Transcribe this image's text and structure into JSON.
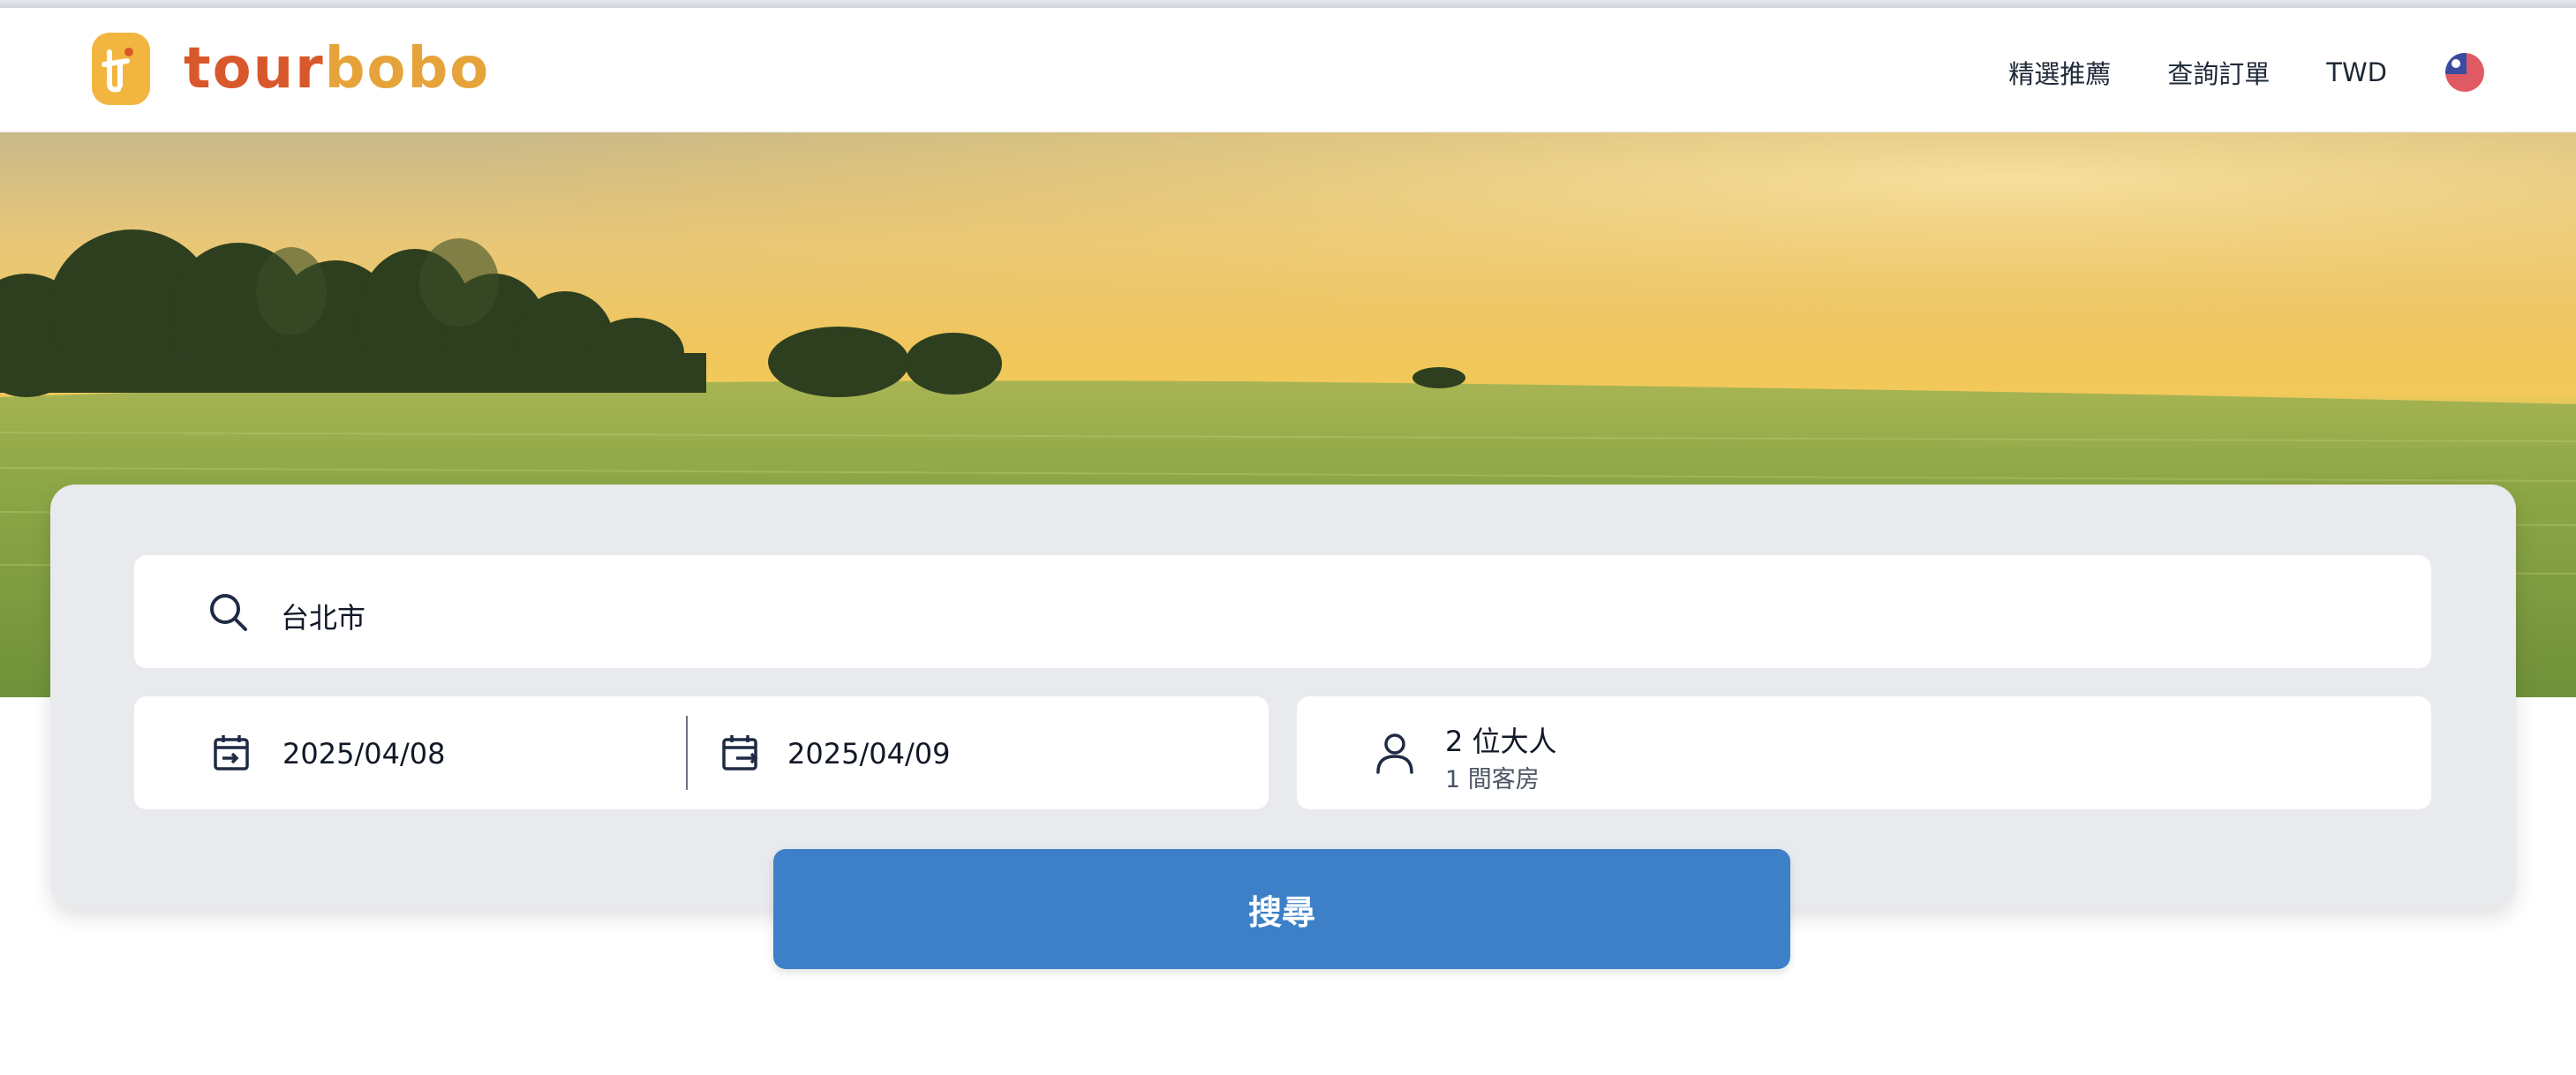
{
  "brand": {
    "name_part1": "tour",
    "name_part2": "bobo",
    "primary_color": "#d9582b",
    "accent_color": "#e6a33a",
    "logo_bg": "#f2b640"
  },
  "nav": {
    "items": [
      {
        "label": "精選推薦"
      },
      {
        "label": "查詢訂單"
      },
      {
        "label": "TWD"
      }
    ],
    "language_flag_icon": "taiwan-flag-icon"
  },
  "search": {
    "destination_value": "台北市",
    "checkin_value": "2025/04/08",
    "checkout_value": "2025/04/09",
    "guests_adults": "2 位大人",
    "guests_rooms": "1 間客房",
    "button_label": "搜尋",
    "button_color": "#3d80c7",
    "icons": {
      "destination": "search-icon",
      "checkin": "calendar-checkin-icon",
      "checkout": "calendar-checkout-icon",
      "guests": "person-icon"
    }
  }
}
